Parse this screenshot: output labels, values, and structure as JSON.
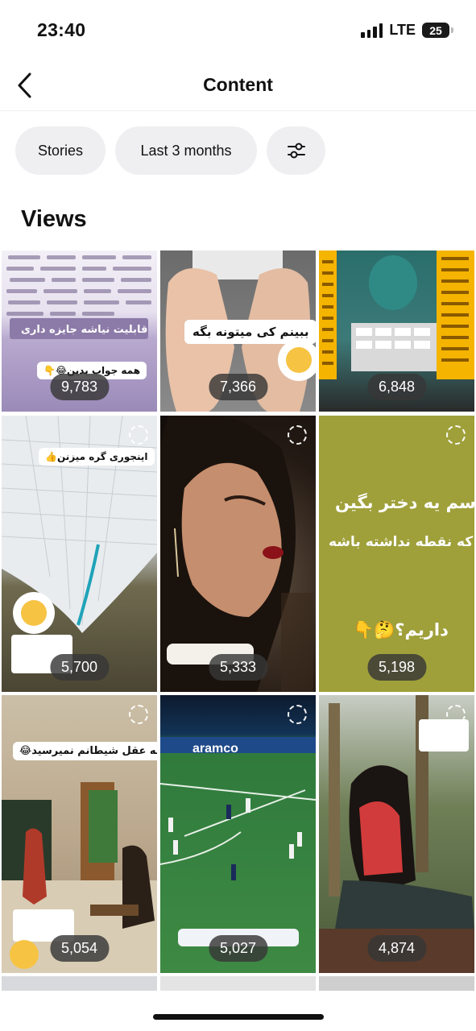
{
  "status_bar": {
    "time": "23:40",
    "network": "LTE",
    "battery": "25"
  },
  "nav": {
    "title": "Content"
  },
  "filters": {
    "stories": "Stories",
    "range": "Last 3 months"
  },
  "section": {
    "heading": "Views"
  },
  "tiles": [
    {
      "views": "9,783",
      "captions": [
        "قابلیت نیاشه جایزه داری",
        "همه جواب بدین😂👇"
      ]
    },
    {
      "views": "7,366",
      "captions": [
        "ببینم کی میتونه بگه"
      ]
    },
    {
      "views": "6,848",
      "captions": []
    },
    {
      "views": "5,700",
      "captions": [
        "اینجوری گره میزنن👍"
      ]
    },
    {
      "views": "5,333",
      "captions": []
    },
    {
      "views": "5,198",
      "captions": [
        "اسم یه دختر بگین",
        "که نقطه نداشته باشه",
        "داریم؟🤔👇"
      ]
    },
    {
      "views": "5,054",
      "captions": [
        "به عقل شیطانم نمیرسید😂"
      ]
    },
    {
      "views": "5,027",
      "captions": [
        "aramco"
      ]
    },
    {
      "views": "4,874",
      "captions": []
    }
  ]
}
